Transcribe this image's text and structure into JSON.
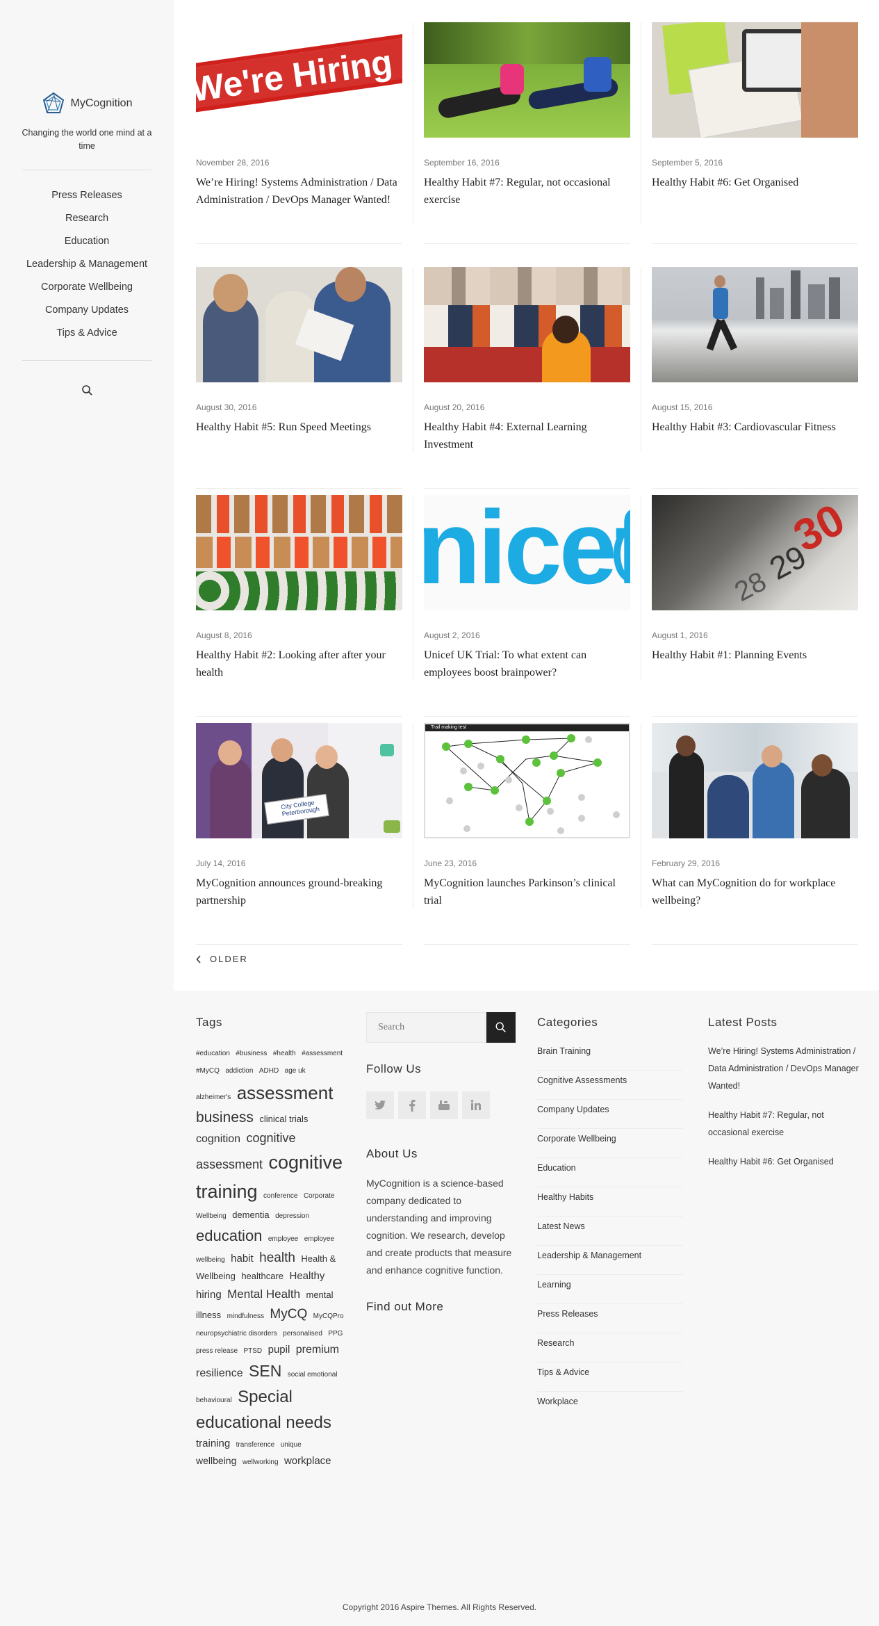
{
  "sidebar": {
    "logo_text": "MyCognition",
    "tagline": "Changing the world one mind at a time",
    "nav": [
      "Press Releases",
      "Research",
      "Education",
      "Leadership & Management",
      "Corporate Wellbeing",
      "Company Updates",
      "Tips & Advice"
    ]
  },
  "posts": [
    {
      "date": "November 28, 2016",
      "title": "We’re Hiring! Systems Administration / Data Administration / DevOps Manager Wanted!",
      "thumb_text": "We're Hiring"
    },
    {
      "date": "September 16, 2016",
      "title": "Healthy Habit #7: Regular, not occasional exercise"
    },
    {
      "date": "September 5, 2016",
      "title": "Healthy Habit #6: Get Organised"
    },
    {
      "date": "August 30, 2016",
      "title": "Healthy Habit #5: Run Speed Meetings"
    },
    {
      "date": "August 20, 2016",
      "title": "Healthy Habit #4: External Learning Investment"
    },
    {
      "date": "August 15, 2016",
      "title": "Healthy Habit #3: Cardiovascular Fitness"
    },
    {
      "date": "August 8, 2016",
      "title": "Healthy Habit #2: Looking after after your health"
    },
    {
      "date": "August 2, 2016",
      "title": "Unicef UK Trial: To what extent can employees boost brainpower?",
      "thumb_text": "nicef"
    },
    {
      "date": "August 1, 2016",
      "title": "Healthy Habit #1: Planning Events",
      "thumb_text": "30"
    },
    {
      "date": "July 14, 2016",
      "title": "MyCognition announces ground-breaking partnership",
      "thumb_text": "City College Peterborough"
    },
    {
      "date": "June 23, 2016",
      "title": "MyCognition launches Parkinson’s clinical trial",
      "thumb_text": "Trail making test"
    },
    {
      "date": "February 29, 2016",
      "title": "What can MyCognition do for workplace wellbeing?"
    }
  ],
  "pagination": {
    "older_label": "OLDER"
  },
  "footer": {
    "tags_heading": "Tags",
    "tags": [
      {
        "t": "#education",
        "s": 10
      },
      {
        "t": "#business",
        "s": 10
      },
      {
        "t": "#health",
        "s": 10
      },
      {
        "t": "#assessment",
        "s": 10
      },
      {
        "t": "#MyCQ",
        "s": 10
      },
      {
        "t": "addiction",
        "s": 10
      },
      {
        "t": "ADHD",
        "s": 10
      },
      {
        "t": "age uk",
        "s": 10
      },
      {
        "t": "alzheimer's",
        "s": 10
      },
      {
        "t": "assessment",
        "s": 26
      },
      {
        "t": "business",
        "s": 21
      },
      {
        "t": "clinical trials",
        "s": 13
      },
      {
        "t": "cognition",
        "s": 16
      },
      {
        "t": "cognitive assessment",
        "s": 18
      },
      {
        "t": "cognitive training",
        "s": 27
      },
      {
        "t": "conference",
        "s": 10
      },
      {
        "t": "Corporate Wellbeing",
        "s": 10
      },
      {
        "t": "dementia",
        "s": 13
      },
      {
        "t": "depression",
        "s": 10
      },
      {
        "t": "education",
        "s": 22
      },
      {
        "t": "employee",
        "s": 10
      },
      {
        "t": "employee wellbeing",
        "s": 10
      },
      {
        "t": "habit",
        "s": 15
      },
      {
        "t": "health",
        "s": 19
      },
      {
        "t": "Health & Wellbeing",
        "s": 13
      },
      {
        "t": "healthcare",
        "s": 13
      },
      {
        "t": "Healthy hiring",
        "s": 15
      },
      {
        "t": "Mental Health",
        "s": 17
      },
      {
        "t": "mental illness",
        "s": 13
      },
      {
        "t": "mindfulness",
        "s": 10
      },
      {
        "t": "MyCQ",
        "s": 19
      },
      {
        "t": "MyCQPro",
        "s": 10
      },
      {
        "t": "neuropsychiatric disorders",
        "s": 10
      },
      {
        "t": "personalised",
        "s": 10
      },
      {
        "t": "PPG",
        "s": 10
      },
      {
        "t": "press release",
        "s": 10
      },
      {
        "t": "PTSD",
        "s": 10
      },
      {
        "t": "pupil",
        "s": 15
      },
      {
        "t": "premium",
        "s": 16
      },
      {
        "t": "resilience",
        "s": 16
      },
      {
        "t": "SEN",
        "s": 23
      },
      {
        "t": "social emotional behavioural",
        "s": 10
      },
      {
        "t": "Special educational needs",
        "s": 24
      },
      {
        "t": "training",
        "s": 15
      },
      {
        "t": "transference",
        "s": 10
      },
      {
        "t": "unique",
        "s": 10
      },
      {
        "t": "wellbeing",
        "s": 14
      },
      {
        "t": "wellworking",
        "s": 10
      },
      {
        "t": "workplace",
        "s": 15
      }
    ],
    "search_placeholder": "Search",
    "follow_heading": "Follow Us",
    "about_heading": "About Us",
    "about_text": "MyCognition is a science-based company dedicated to understanding and improving cognition. We research, develop and create products that measure and enhance cognitive function.",
    "find_more": "Find out More",
    "categories_heading": "Categories",
    "categories": [
      "Brain Training",
      "Cognitive Assessments",
      "Company Updates",
      "Corporate Wellbeing",
      "Education",
      "Healthy Habits",
      "Latest News",
      "Leadership & Management",
      "Learning",
      "Press Releases",
      "Research",
      "Tips & Advice",
      "Workplace"
    ],
    "latest_heading": "Latest Posts",
    "latest": [
      "We’re Hiring! Systems Administration / Data Administration / DevOps Manager Wanted!",
      "Healthy Habit #7: Regular, not occasional exercise",
      "Healthy Habit #6: Get Organised"
    ],
    "copyright": "Copyright 2016 Aspire Themes. All Rights Reserved."
  },
  "colors": {
    "accent": "#222222",
    "sidebar_bg": "#f7f7f7",
    "footer_bg": "#f7f7f7"
  }
}
